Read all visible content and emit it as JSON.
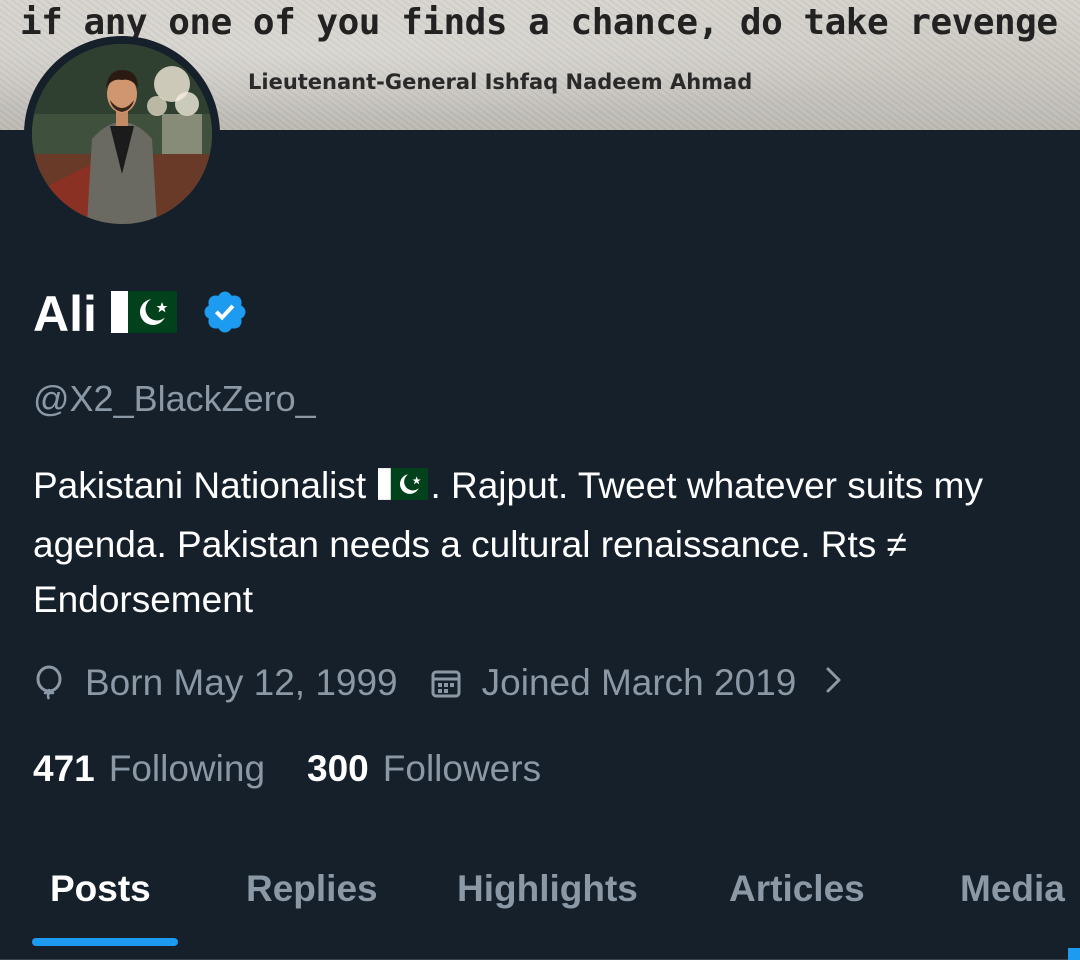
{
  "banner": {
    "quote": "if any one of you finds a chance, do take revenge",
    "author": "Lieutenant-General Ishfaq Nadeem Ahmad"
  },
  "profile": {
    "display_name": "Ali",
    "handle": "@X2_BlackZero_",
    "verified": true,
    "bio_part1": "Pakistani Nationalist",
    "bio_part2": ". Rajput. Tweet whatever suits my agenda. Pakistan needs a cultural renaissance. Rts ≠ Endorsement",
    "birthday": "Born May 12, 1999",
    "joined": "Joined March 2019"
  },
  "stats": {
    "following_count": "471",
    "following_label": "Following",
    "followers_count": "300",
    "followers_label": "Followers"
  },
  "tabs": [
    {
      "label": "Posts",
      "active": true
    },
    {
      "label": "Replies",
      "active": false
    },
    {
      "label": "Highlights",
      "active": false
    },
    {
      "label": "Articles",
      "active": false
    },
    {
      "label": "Media",
      "active": false
    }
  ],
  "colors": {
    "background": "#15202b",
    "accent": "#1d9bf0",
    "secondary_text": "#8b98a5",
    "flag_green": "#01411c"
  }
}
